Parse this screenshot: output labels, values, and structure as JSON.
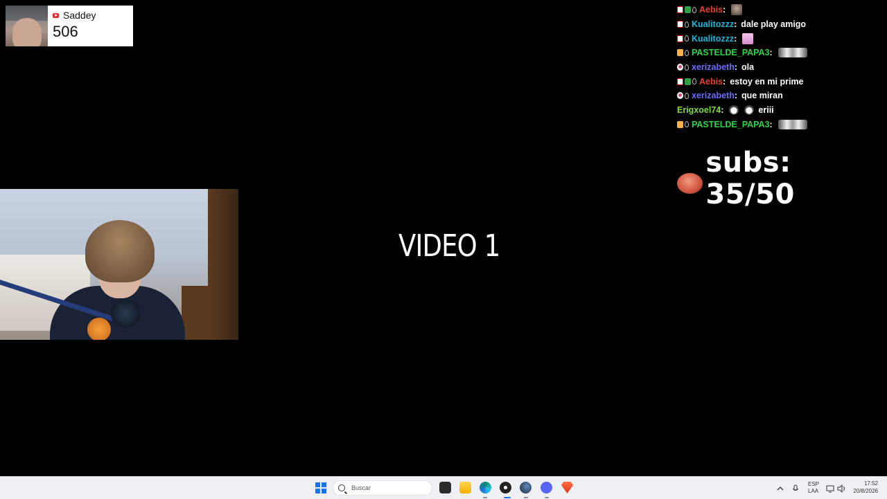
{
  "youtube_widget": {
    "channel_name": "Saddey",
    "count": "506"
  },
  "chat": {
    "messages": [
      {
        "user": "Aebis",
        "color": "#e8402a",
        "badges": [
          "pen",
          "sub",
          "drop"
        ],
        "text": "",
        "emote": "dark"
      },
      {
        "user": "Kualitozzz",
        "color": "#19b8d8",
        "badges": [
          "pen",
          "drop"
        ],
        "text": "dale play amigo",
        "emote": ""
      },
      {
        "user": "Kualitozzz",
        "color": "#19b8d8",
        "badges": [
          "pen",
          "drop"
        ],
        "text": "",
        "emote": "pink"
      },
      {
        "user": "PASTELDE_PAPA3",
        "color": "#35d14b",
        "badges": [
          "gift",
          "drop"
        ],
        "text": "",
        "emote": "wide"
      },
      {
        "user": "xerizabeth",
        "color": "#6c6cff",
        "badges": [
          "heart",
          "drop"
        ],
        "text": "ola",
        "emote": ""
      },
      {
        "user": "Aebis",
        "color": "#e8402a",
        "badges": [
          "pen",
          "sub",
          "drop"
        ],
        "text": "estoy en mi prime",
        "emote": ""
      },
      {
        "user": "xerizabeth",
        "color": "#6c6cff",
        "badges": [
          "heart",
          "drop"
        ],
        "text": "que miran",
        "emote": ""
      },
      {
        "user": "Erigxoel74",
        "color": "#7bdc44",
        "badges": [],
        "text": "eriii",
        "emote": "cats"
      },
      {
        "user": "PASTELDE_PAPA3",
        "color": "#35d14b",
        "badges": [
          "gift",
          "drop"
        ],
        "text": "",
        "emote": "wide"
      }
    ]
  },
  "subs_goal": {
    "text": "subs: 35/50",
    "current": 35,
    "goal": 50
  },
  "video": {
    "label": "VIDEO 1"
  },
  "taskbar": {
    "search_placeholder": "Buscar",
    "lang_line1": "ESP",
    "lang_line2": "LAA",
    "time": "17:52",
    "date": "20/8/2026",
    "apps": [
      "file-explorer-icon",
      "edge-icon",
      "obs-icon",
      "steam-icon",
      "discord-icon",
      "brave-icon"
    ]
  }
}
